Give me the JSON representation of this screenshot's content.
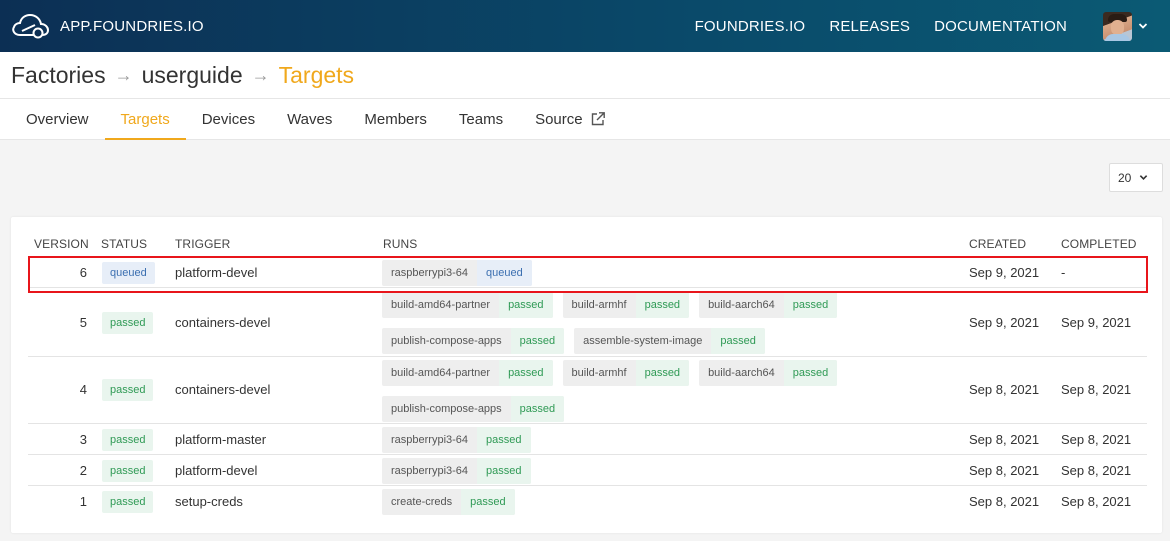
{
  "app": {
    "name": "APP.FOUNDRIES.IO"
  },
  "topnav": {
    "items": [
      "FOUNDRIES.IO",
      "RELEASES",
      "DOCUMENTATION"
    ]
  },
  "breadcrumb": {
    "items": [
      "Factories",
      "userguide",
      "Targets"
    ],
    "separator": "→"
  },
  "tabs": [
    {
      "label": "Overview"
    },
    {
      "label": "Targets",
      "active": true
    },
    {
      "label": "Devices"
    },
    {
      "label": "Waves"
    },
    {
      "label": "Members"
    },
    {
      "label": "Teams"
    },
    {
      "label": "Source",
      "icon": "external-link-icon"
    }
  ],
  "page_size": {
    "value": "20"
  },
  "table": {
    "headers": {
      "version": "VERSION",
      "status": "STATUS",
      "trigger": "TRIGGER",
      "runs": "RUNS",
      "created": "CREATED",
      "completed": "COMPLETED"
    },
    "rows": [
      {
        "version": "6",
        "status": "queued",
        "trigger": "platform-devel",
        "runs": [
          {
            "name": "raspberrypi3-64",
            "status": "queued"
          }
        ],
        "created": "Sep 9, 2021",
        "completed": "-"
      },
      {
        "version": "5",
        "status": "passed",
        "trigger": "containers-devel",
        "runs": [
          {
            "name": "build-amd64-partner",
            "status": "passed"
          },
          {
            "name": "build-armhf",
            "status": "passed"
          },
          {
            "name": "build-aarch64",
            "status": "passed"
          },
          {
            "name": "publish-compose-apps",
            "status": "passed"
          },
          {
            "name": "assemble-system-image",
            "status": "passed"
          }
        ],
        "created": "Sep 9, 2021",
        "completed": "Sep 9, 2021"
      },
      {
        "version": "4",
        "status": "passed",
        "trigger": "containers-devel",
        "runs": [
          {
            "name": "build-amd64-partner",
            "status": "passed"
          },
          {
            "name": "build-armhf",
            "status": "passed"
          },
          {
            "name": "build-aarch64",
            "status": "passed"
          },
          {
            "name": "publish-compose-apps",
            "status": "passed"
          }
        ],
        "created": "Sep 8, 2021",
        "completed": "Sep 8, 2021"
      },
      {
        "version": "3",
        "status": "passed",
        "trigger": "platform-master",
        "runs": [
          {
            "name": "raspberrypi3-64",
            "status": "passed"
          }
        ],
        "created": "Sep 8, 2021",
        "completed": "Sep 8, 2021"
      },
      {
        "version": "2",
        "status": "passed",
        "trigger": "platform-devel",
        "runs": [
          {
            "name": "raspberrypi3-64",
            "status": "passed"
          }
        ],
        "created": "Sep 8, 2021",
        "completed": "Sep 8, 2021"
      },
      {
        "version": "1",
        "status": "passed",
        "trigger": "setup-creds",
        "runs": [
          {
            "name": "create-creds",
            "status": "passed"
          }
        ],
        "created": "Sep 8, 2021",
        "completed": "Sep 8, 2021"
      }
    ]
  },
  "colors": {
    "accent": "#f0a81c",
    "passed": "#2f9a55",
    "queued": "#3b6fb0",
    "highlight": "#e8151b",
    "header_bg": "#0c2f54"
  }
}
